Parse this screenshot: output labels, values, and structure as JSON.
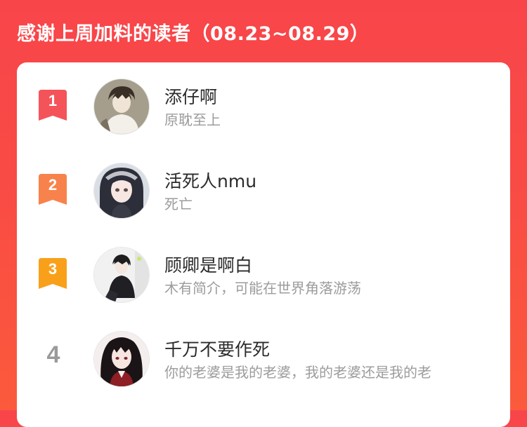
{
  "header": {
    "title": "感谢上周加料的读者（08.23~08.29）"
  },
  "colors": {
    "badge_1": "#f5535a",
    "badge_2": "#f8824b",
    "badge_3": "#f9a01b",
    "rank_plain": "#9a9a9a"
  },
  "readers": [
    {
      "rank": "1",
      "name": "添仔啊",
      "bio": "原耽至上",
      "avatar_icon": "user-avatar-icon"
    },
    {
      "rank": "2",
      "name": "活死人nmu",
      "bio": "死亡",
      "avatar_icon": "user-avatar-icon"
    },
    {
      "rank": "3",
      "name": "顾卿是啊白",
      "bio": "木有简介，可能在世界角落游荡",
      "avatar_icon": "user-avatar-icon"
    },
    {
      "rank": "4",
      "name": "千万不要作死",
      "bio": "你的老婆是我的老婆，我的老婆还是我的老",
      "avatar_icon": "user-avatar-icon"
    }
  ]
}
